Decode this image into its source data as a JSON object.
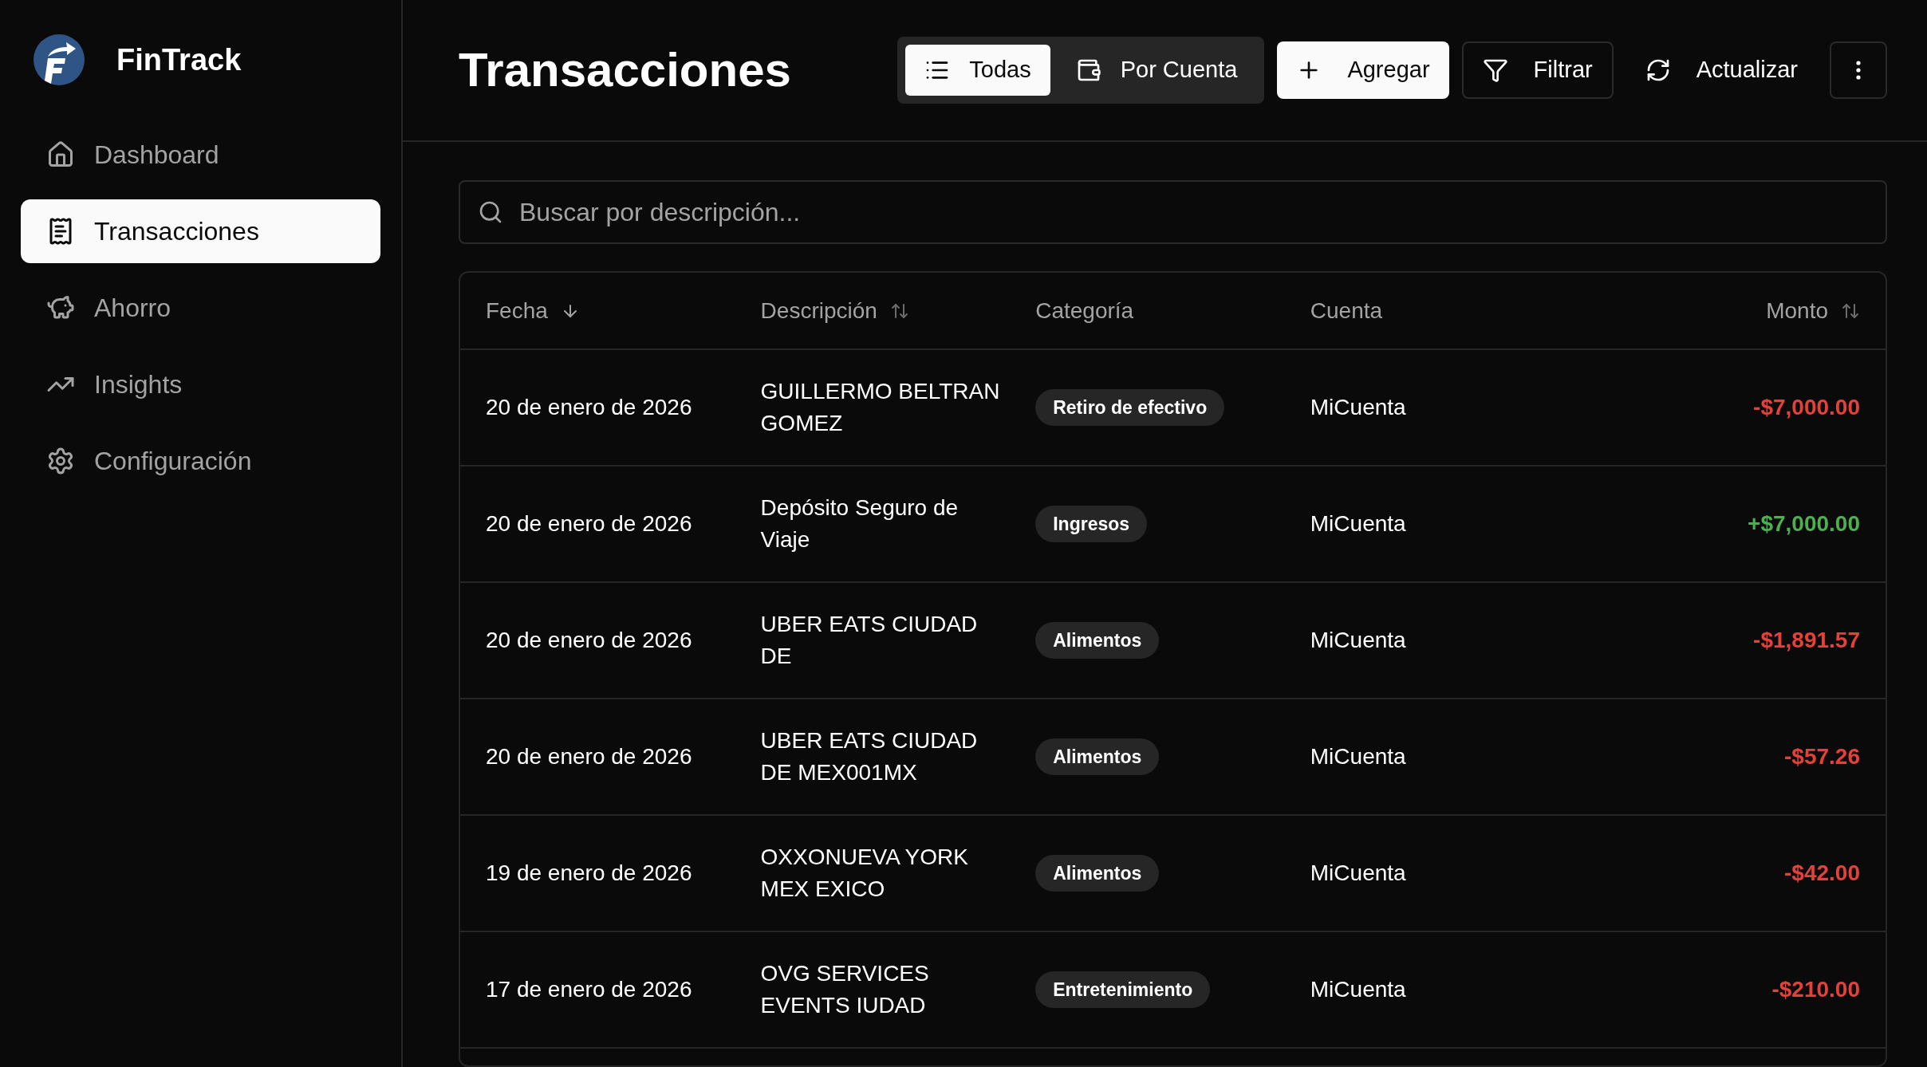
{
  "app": {
    "name": "FinTrack"
  },
  "sidebar": {
    "items": [
      {
        "label": "Dashboard",
        "selected": false
      },
      {
        "label": "Transacciones",
        "selected": true
      },
      {
        "label": "Ahorro",
        "selected": false
      },
      {
        "label": "Insights",
        "selected": false
      },
      {
        "label": "Configuración",
        "selected": false
      }
    ]
  },
  "header": {
    "title": "Transacciones",
    "view_toggle": [
      {
        "label": "Todas",
        "selected": true
      },
      {
        "label": "Por Cuenta",
        "selected": false
      }
    ],
    "buttons": [
      {
        "label": "Agregar",
        "kind": "primary"
      },
      {
        "label": "Filtrar",
        "kind": "outline"
      },
      {
        "label": "Actualizar",
        "kind": "ghost"
      }
    ]
  },
  "search": {
    "placeholder": "Buscar por descripción..."
  },
  "table": {
    "columns": [
      {
        "label": "Fecha",
        "kind": "descending"
      },
      {
        "label": "Descripción",
        "kind": "sortable"
      },
      {
        "label": "Categoría",
        "kind": "plain"
      },
      {
        "label": "Cuenta",
        "kind": "plain"
      },
      {
        "label": "Monto",
        "kind": "sortable"
      }
    ],
    "rows": [
      {
        "date": "20 de enero de 2026",
        "description": "GUILLERMO BELTRAN GOMEZ",
        "category": "Retiro de efectivo",
        "account": "MiCuenta",
        "amount": "-$7,000.00",
        "kind": "expense"
      },
      {
        "date": "20 de enero de 2026",
        "description": "Depósito Seguro de Viaje",
        "category": "Ingresos",
        "account": "MiCuenta",
        "amount": "+$7,000.00",
        "kind": "income"
      },
      {
        "date": "20 de enero de 2026",
        "description": "UBER EATS CIUDAD DE",
        "category": "Alimentos",
        "account": "MiCuenta",
        "amount": "-$1,891.57",
        "kind": "expense"
      },
      {
        "date": "20 de enero de 2026",
        "description": "UBER EATS CIUDAD DE MEX001MX",
        "category": "Alimentos",
        "account": "MiCuenta",
        "amount": "-$57.26",
        "kind": "expense"
      },
      {
        "date": "19 de enero de 2026",
        "description": "OXXONUEVA YORK MEX EXICO",
        "category": "Alimentos",
        "account": "MiCuenta",
        "amount": "-$42.00",
        "kind": "expense"
      },
      {
        "date": "17 de enero de 2026",
        "description": "OVG SERVICES EVENTS IUDAD",
        "category": "Entretenimiento",
        "account": "MiCuenta",
        "amount": "-$210.00",
        "kind": "expense"
      }
    ]
  }
}
